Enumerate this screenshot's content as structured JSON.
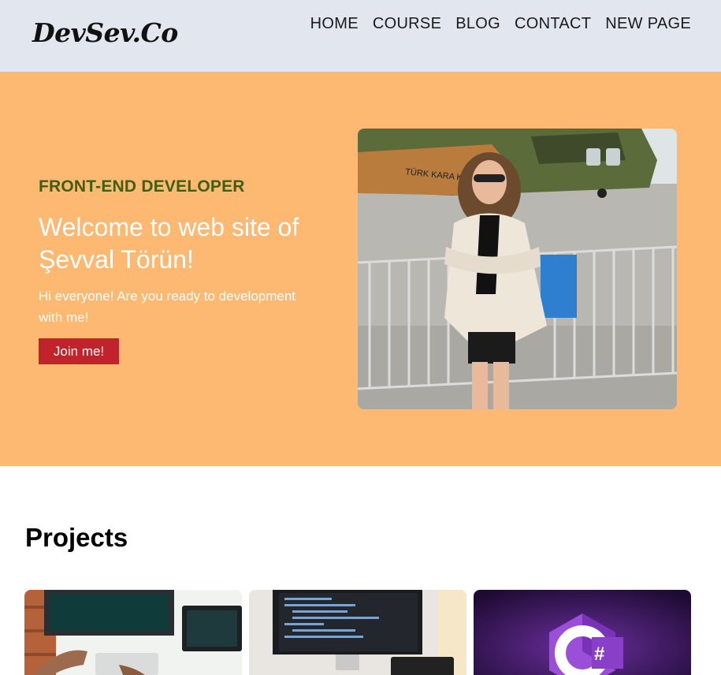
{
  "header": {
    "logo": "DevSev.Co",
    "nav": [
      "HOME",
      "COURSE",
      "BLOG",
      "CONTACT",
      "NEW PAGE"
    ]
  },
  "hero": {
    "subtitle": "FRONT-END DEVELOPER",
    "title": "Welcome to web site of Şevval Törün!",
    "text": "Hi everyone! Are you ready to development with me!",
    "button": "Join me!",
    "accent_color": "#fdb871",
    "button_color": "#c0232c"
  },
  "projects": {
    "title": "Projects",
    "cards": [
      {
        "image": "workspace-photo"
      },
      {
        "image": "code-monitor-photo"
      },
      {
        "image": "csharp-logo",
        "logo_text": "C#"
      }
    ]
  }
}
